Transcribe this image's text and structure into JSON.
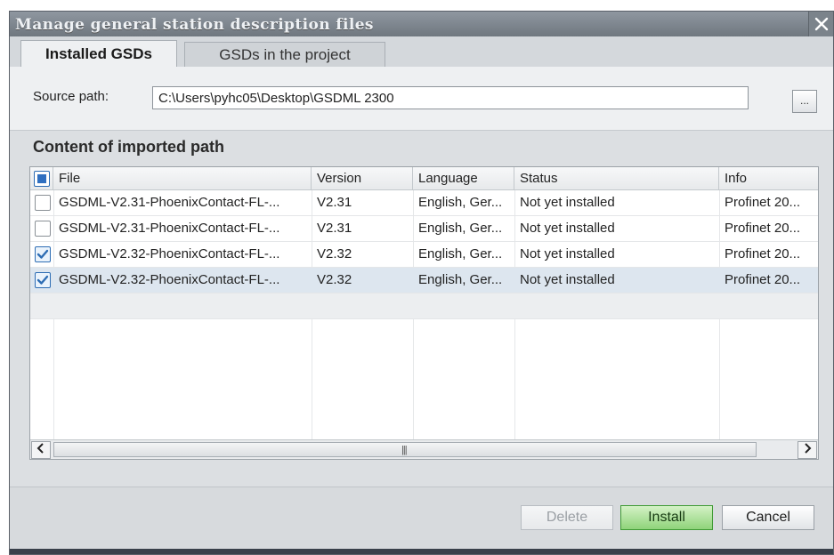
{
  "window": {
    "title": "Manage general station description files"
  },
  "tabs": [
    {
      "label": "Installed GSDs",
      "active": true
    },
    {
      "label": "GSDs in the project",
      "active": false
    }
  ],
  "source": {
    "label": "Source path:",
    "value": "C:\\Users\\pyhc05\\Desktop\\GSDML 2300",
    "browse_label": "..."
  },
  "content": {
    "section_title": "Content of imported path",
    "columns": [
      "File",
      "Version",
      "Language",
      "Status",
      "Info"
    ],
    "rows": [
      {
        "checked": false,
        "file": "GSDML-V2.31-PhoenixContact-FL-...",
        "version": "V2.31",
        "language": "English, Ger...",
        "status": "Not yet installed",
        "info": "Profinet 20..."
      },
      {
        "checked": false,
        "file": "GSDML-V2.31-PhoenixContact-FL-...",
        "version": "V2.31",
        "language": "English, Ger...",
        "status": "Not yet installed",
        "info": "Profinet 20..."
      },
      {
        "checked": true,
        "file": "GSDML-V2.32-PhoenixContact-FL-...",
        "version": "V2.32",
        "language": "English, Ger...",
        "status": "Not yet installed",
        "info": "Profinet 20..."
      },
      {
        "checked": true,
        "file": "GSDML-V2.32-PhoenixContact-FL-...",
        "version": "V2.32",
        "language": "English, Ger...",
        "status": "Not yet installed",
        "info": "Profinet 20..."
      }
    ]
  },
  "buttons": {
    "delete": "Delete",
    "install": "Install",
    "cancel": "Cancel"
  },
  "colors": {
    "accent_check": "#2e6db4",
    "install_green": "#8fd37a",
    "titlebar": "#7a828a"
  }
}
